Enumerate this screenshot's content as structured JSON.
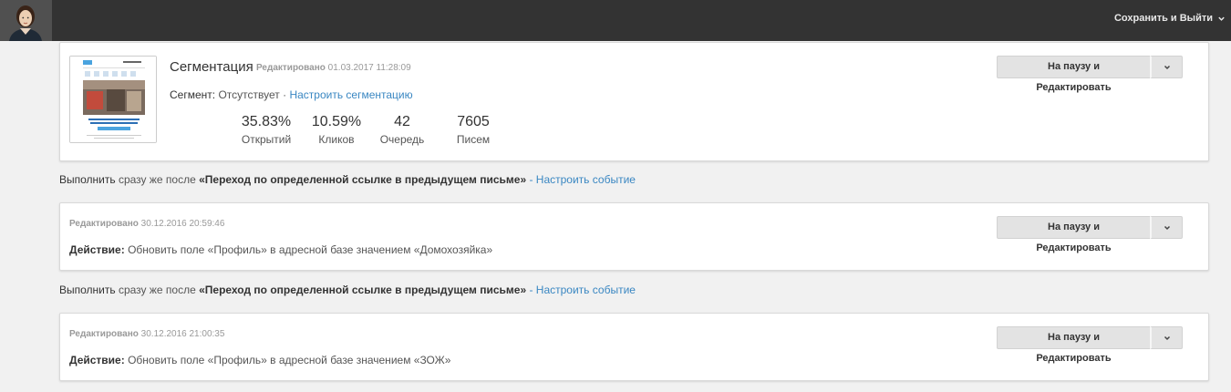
{
  "header": {
    "save_exit_label": "Сохранить и Выйти"
  },
  "email_card": {
    "title": "Сегментация",
    "edited_label": "Редактировано",
    "edited_date": "01.03.2017 11:28:09",
    "segment_label": "Сегмент:",
    "segment_value": "Отсутствует",
    "segment_separator": "·",
    "segment_link": "Настроить сегментацию",
    "stats": [
      {
        "value": "35.83%",
        "caption": "Открытий"
      },
      {
        "value": "10.59%",
        "caption": "Кликов"
      },
      {
        "value": "42",
        "caption": "Очередь"
      },
      {
        "value": "7605",
        "caption": "Писем"
      }
    ],
    "button_label": "На паузу и Редактировать"
  },
  "triggers": [
    {
      "run_label": "Выполнить",
      "run_text": " сразу же после ",
      "event": "«Переход по определенной ссылке в предыдущем письме»",
      "link": "- Настроить событие"
    },
    {
      "run_label": "Выполнить",
      "run_text": " сразу же после ",
      "event": "«Переход по определенной ссылке в предыдущем письме»",
      "link": "- Настроить событие"
    }
  ],
  "action_cards": [
    {
      "edited_label": "Редактировано",
      "edited_date": "30.12.2016 20:59:46",
      "action_label": "Действие:",
      "action_text": " Обновить поле «Профиль» в адресной базе значением «Домохозяйка»",
      "button_label": "На паузу и Редактировать"
    },
    {
      "edited_label": "Редактировано",
      "edited_date": "30.12.2016 21:00:35",
      "action_label": "Действие:",
      "action_text": " Обновить поле «Профиль» в адресной базе значением «ЗОЖ»",
      "button_label": "На паузу и Редактировать"
    }
  ],
  "icons": {
    "avatar": "user-avatar-icon",
    "chevron": "chevron-down-icon"
  },
  "colors": {
    "topbar": "#333333",
    "link": "#3a87c2",
    "background": "#f1f1f1"
  }
}
